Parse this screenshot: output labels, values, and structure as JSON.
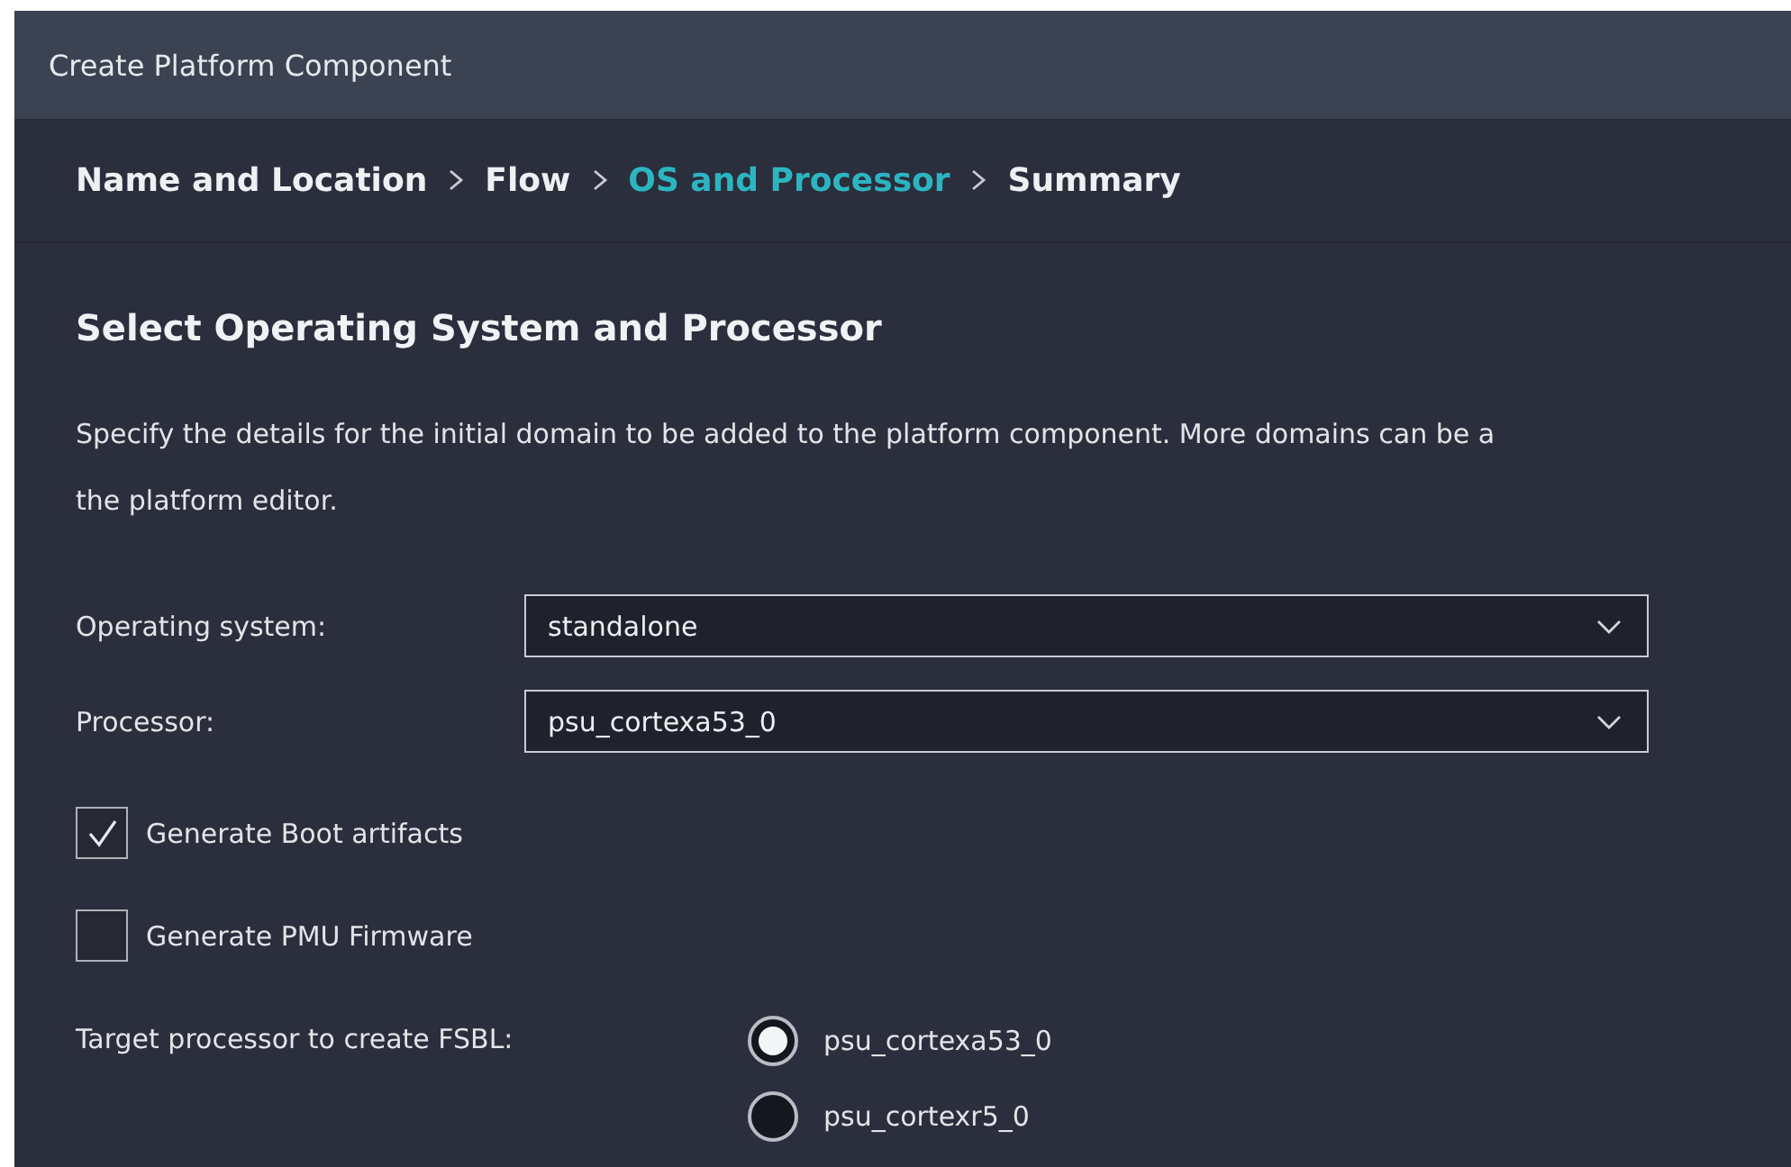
{
  "window": {
    "title": "Create Platform Component"
  },
  "breadcrumb": [
    {
      "label": "Name and Location",
      "selected": false
    },
    {
      "label": "Flow",
      "selected": false
    },
    {
      "label": "OS and Processor",
      "selected": true
    },
    {
      "label": "Summary",
      "selected": false
    }
  ],
  "heading": "Select Operating System and Processor",
  "description": [
    "Specify the details for the initial domain to be added to the platform component. More domains can be a",
    "the platform editor."
  ],
  "fields": [
    {
      "label": "Operating system:",
      "value": "standalone"
    },
    {
      "label": "Processor:",
      "value": "psu_cortexa53_0"
    }
  ],
  "checkboxes": [
    {
      "label": "Generate Boot artifacts",
      "checked": true
    },
    {
      "label": "Generate PMU Firmware",
      "checked": false
    }
  ],
  "fsbl": {
    "label": "Target processor to create FSBL:",
    "options": [
      {
        "label": "psu_cortexa53_0",
        "selected": true
      },
      {
        "label": "psu_cortexr5_0",
        "selected": false
      }
    ]
  }
}
